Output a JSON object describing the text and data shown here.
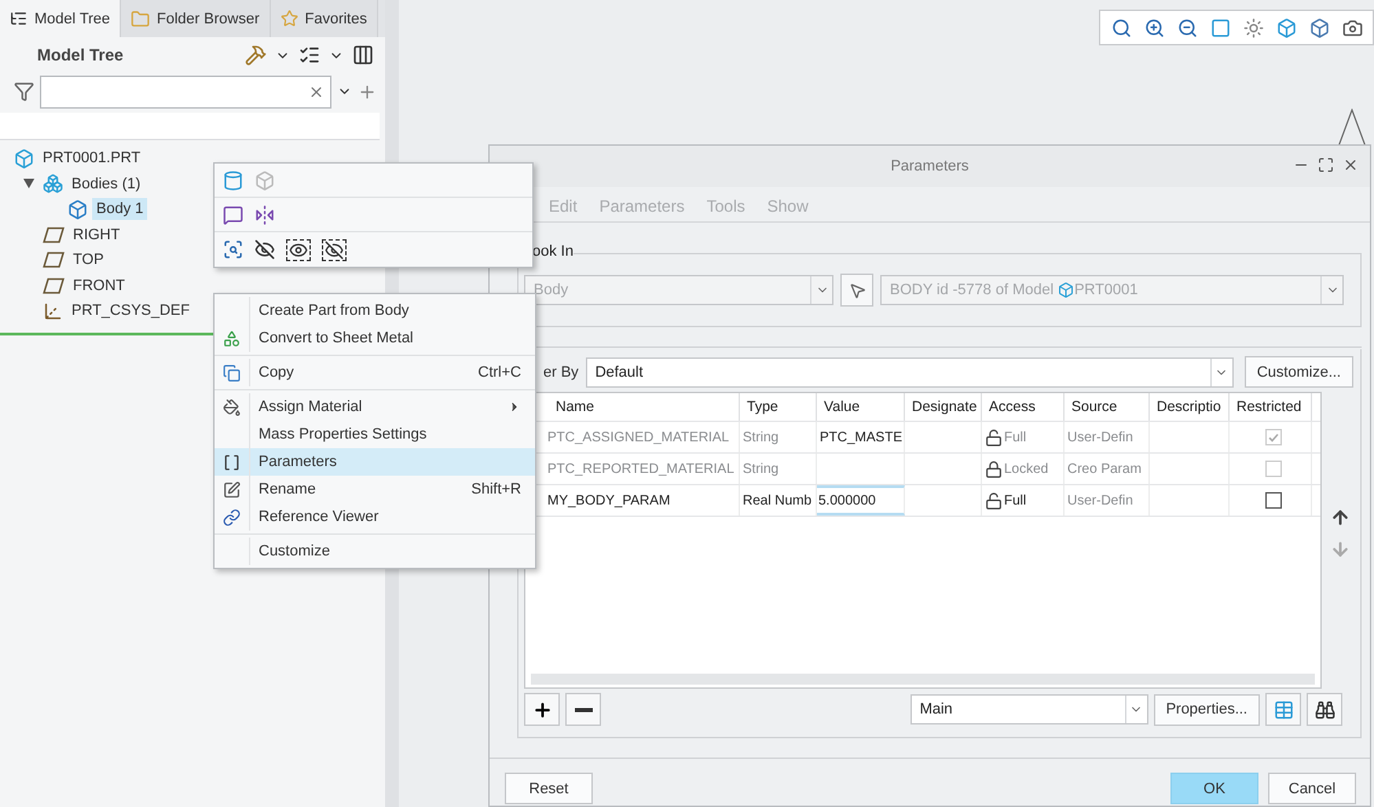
{
  "left_panel": {
    "tabs": [
      {
        "label": "Model Tree",
        "selected": true
      },
      {
        "label": "Folder Browser",
        "selected": false
      },
      {
        "label": "Favorites",
        "selected": false
      }
    ],
    "title": "Model Tree",
    "tree": [
      {
        "label": "PRT0001.PRT",
        "kind": "part",
        "selected": false,
        "children": [
          {
            "label": "Bodies (1)",
            "kind": "bodies",
            "selected": false,
            "expanded": true,
            "children": [
              {
                "label": "Body 1",
                "kind": "body",
                "selected": true
              }
            ]
          },
          {
            "label": "RIGHT",
            "kind": "plane",
            "selected": false
          },
          {
            "label": "TOP",
            "kind": "plane",
            "selected": false
          },
          {
            "label": "FRONT",
            "kind": "plane",
            "selected": false
          },
          {
            "label": "PRT_CSYS_DEF",
            "kind": "csys",
            "selected": false
          }
        ]
      }
    ]
  },
  "context_menu": {
    "groups": [
      [
        {
          "label": "Create Part from Body",
          "submenu": false,
          "selected": false
        },
        {
          "label": "Convert to Sheet Metal",
          "submenu": false,
          "selected": false
        }
      ],
      [
        {
          "label": "Copy",
          "shortcut": "Ctrl+C",
          "submenu": false,
          "selected": false
        }
      ],
      [
        {
          "label": "Assign Material",
          "submenu": true,
          "selected": false
        },
        {
          "label": "Mass Properties Settings",
          "submenu": false,
          "selected": false
        },
        {
          "label": "Parameters",
          "submenu": false,
          "selected": true
        },
        {
          "label": "Rename",
          "shortcut": "Shift+R",
          "submenu": false,
          "selected": false
        },
        {
          "label": "Reference Viewer",
          "submenu": false,
          "selected": false
        }
      ],
      [
        {
          "label": "Customize",
          "submenu": false,
          "selected": false
        }
      ]
    ]
  },
  "dialog": {
    "title": "Parameters",
    "menu": [
      {
        "label": "Edit",
        "disabled": true
      },
      {
        "label": "Parameters",
        "disabled": true
      },
      {
        "label": "Tools",
        "disabled": true
      },
      {
        "label": "Show",
        "disabled": true
      }
    ],
    "look_in": {
      "label": "ook In",
      "type_combo": {
        "value": "Body",
        "disabled": true
      },
      "target_combo": {
        "value": "BODY  id -5778 of Model",
        "model": "PRT0001",
        "disabled": true
      }
    },
    "filter": {
      "label": "er By",
      "value": "Default"
    },
    "customize_button": "Customize...",
    "table": {
      "columns": [
        "Name",
        "Type",
        "Value",
        "Designate",
        "Access",
        "Source",
        "Descriptio",
        "Restricted"
      ],
      "rows": [
        {
          "name": "PTC_ASSIGNED_MATERIAL",
          "type": "String",
          "value": "PTC_MASTE",
          "access": "Full",
          "locked": false,
          "source": "User-Defin",
          "restricted": true,
          "disabled": true,
          "editing": false
        },
        {
          "name": "PTC_REPORTED_MATERIAL",
          "type": "String",
          "value": "",
          "access": "Locked",
          "locked": true,
          "source": "Creo Param",
          "restricted": false,
          "disabled": true,
          "editing": false
        },
        {
          "name": "MY_BODY_PARAM",
          "type": "Real Numb",
          "value": "5.000000",
          "access": "Full",
          "locked": false,
          "source": "User-Defin",
          "restricted": false,
          "disabled": false,
          "editing": true
        }
      ]
    },
    "view_combo": "Main",
    "properties_button": "Properties...",
    "buttons": [
      {
        "label": "Reset",
        "default": false
      },
      {
        "label": "OK",
        "default": true
      },
      {
        "label": "Cancel",
        "default": false
      }
    ]
  }
}
